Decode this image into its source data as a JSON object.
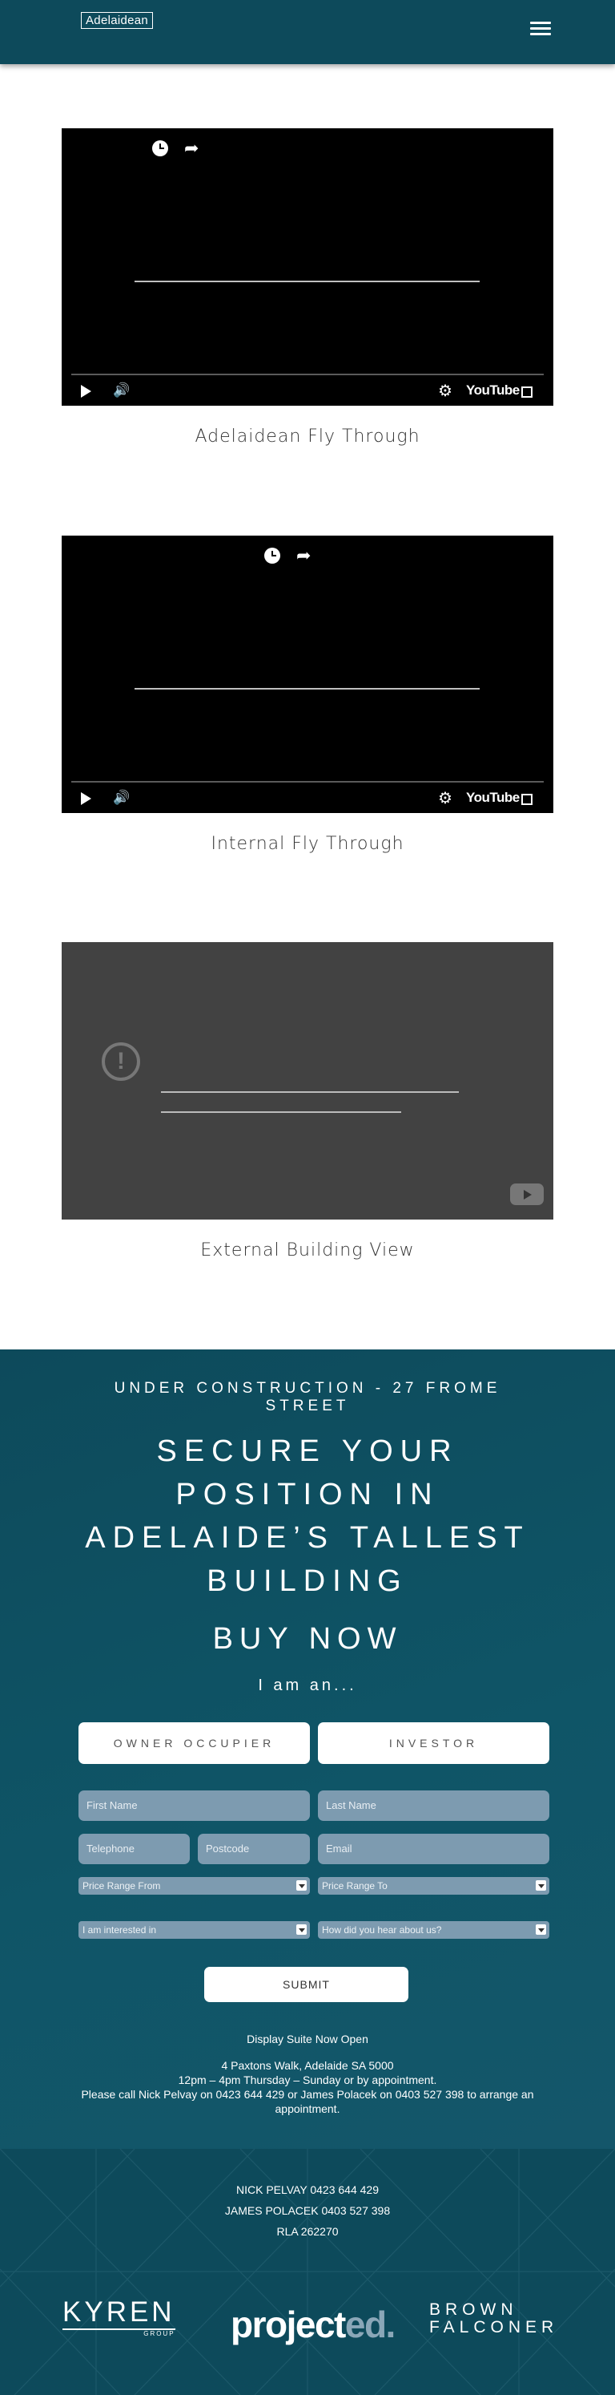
{
  "header": {
    "logo_text": "Adelaidean",
    "menu_icon": "hamburger-icon"
  },
  "videos": [
    {
      "caption": "Adelaidean Fly Through",
      "brand": "YouTube"
    },
    {
      "caption": "Internal Fly Through",
      "brand": "YouTube"
    },
    {
      "caption": "External Building View"
    }
  ],
  "register": {
    "eyebrow": "UNDER CONSTRUCTION -  27 FROME STREET",
    "headline": "SECURE YOUR POSITION IN ADELAIDE’S TALLEST BUILDING",
    "buy_now": "BUY NOW",
    "i_am": "I am an...",
    "choices": [
      "OWNER OCCUPIER",
      "INVESTOR"
    ],
    "fields": {
      "first_name": "First Name",
      "last_name": "Last Name",
      "telephone": "Telephone",
      "postcode": "Postcode",
      "email": "Email"
    },
    "selects": {
      "price_from": "Price Range From",
      "price_to": "Price Range To",
      "interested_in": "I am interested in",
      "heard_about": "How did you hear about us?"
    },
    "submit": "SUBMIT",
    "info": {
      "line1": "Display Suite Now Open",
      "line2": "4 Paxtons Walk, Adelaide SA 5000",
      "line3": "12pm – 4pm Thursday – Sunday or by appointment.",
      "line4": "Please call Nick Pelvay on 0423 644 429 or James Polacek on 0403 527 398 to arrange an appointment."
    }
  },
  "footer": {
    "contact1": "NICK PELVAY   0423 644 429",
    "contact2": "JAMES POLACEK   0403 527 398",
    "rla": "RLA 262270",
    "logos": {
      "kyren": "KYREN",
      "kyren_sub": "GROUP",
      "projected_main": "project",
      "projected_accent": "ed.",
      "brown_line1": "BROWN",
      "brown_line2": "FALCONER"
    }
  }
}
